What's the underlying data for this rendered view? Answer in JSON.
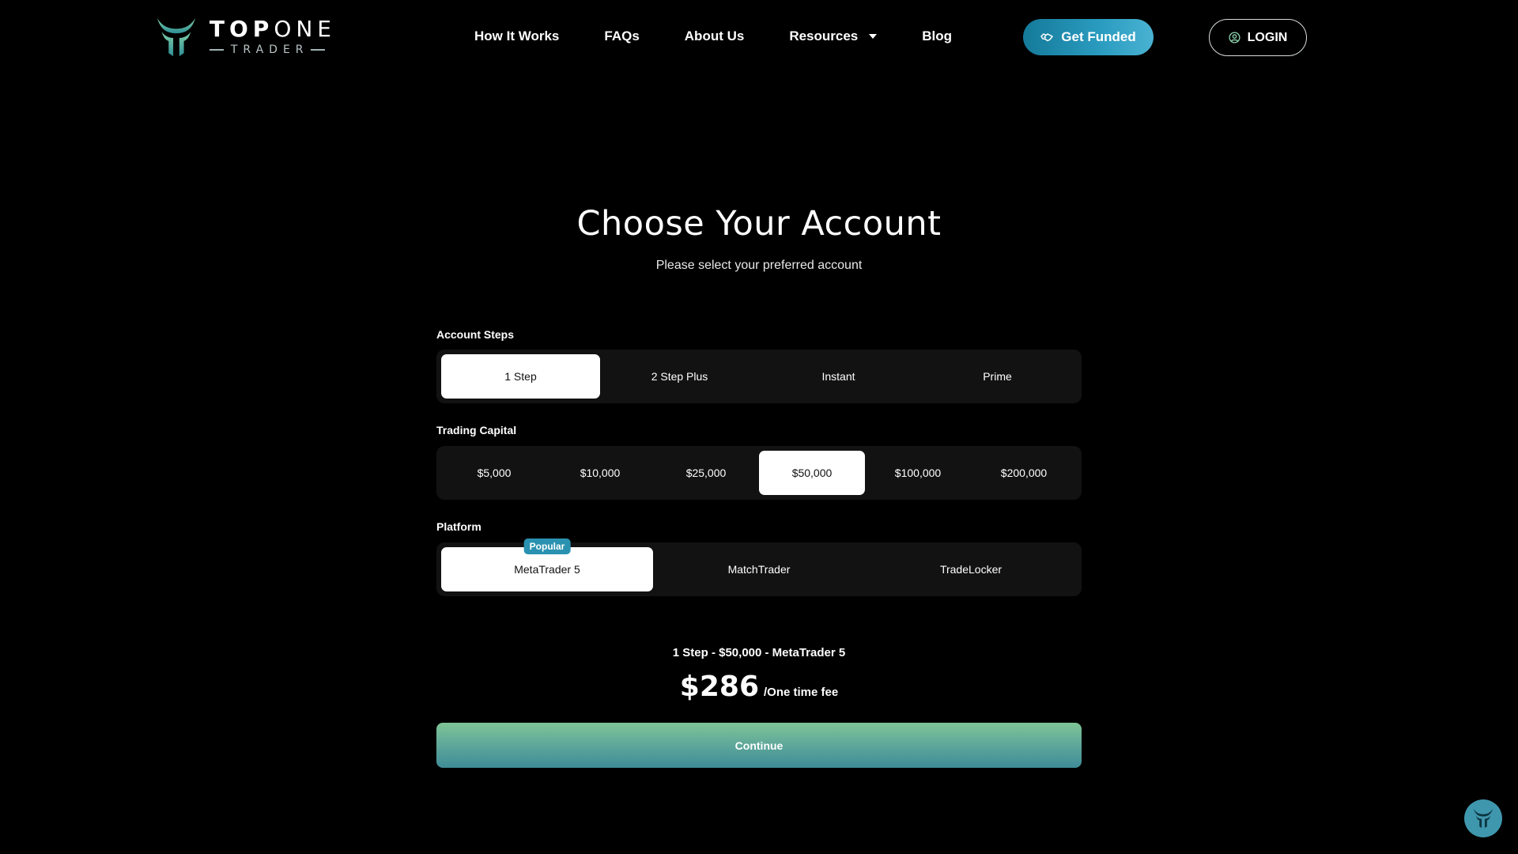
{
  "brand": {
    "name_bold": "TOP",
    "name_regular": "ONE",
    "tagline": "TRADER",
    "accent_color": "#5fb7a0"
  },
  "nav": {
    "items": [
      {
        "label": "How It Works"
      },
      {
        "label": "FAQs"
      },
      {
        "label": "About Us"
      },
      {
        "label": "Resources",
        "has_dropdown": true
      },
      {
        "label": "Blog"
      }
    ],
    "get_funded_label": "Get Funded",
    "login_label": "LOGIN",
    "get_funded_color": "#2a9cc0"
  },
  "main": {
    "title": "Choose Your Account",
    "subtitle": "Please select your preferred account"
  },
  "account_steps": {
    "label": "Account Steps",
    "options": [
      "1 Step",
      "2 Step Plus",
      "Instant",
      "Prime"
    ],
    "selected": "1 Step"
  },
  "trading_capital": {
    "label": "Trading Capital",
    "options": [
      "$5,000",
      "$10,000",
      "$25,000",
      "$50,000",
      "$100,000",
      "$200,000"
    ],
    "selected": "$50,000"
  },
  "platform": {
    "label": "Platform",
    "options": [
      "MetaTrader 5",
      "MatchTrader",
      "TradeLocker"
    ],
    "selected": "MetaTrader 5",
    "badge": "Popular"
  },
  "summary": {
    "selection": "1 Step - $50,000 - MetaTrader 5",
    "price": "$286",
    "price_note": "/One time fee",
    "continue_label": "Continue"
  },
  "icons": {
    "get_funded": "handshake-icon",
    "login": "user-circle-icon",
    "chat": "chat-logo-icon"
  }
}
